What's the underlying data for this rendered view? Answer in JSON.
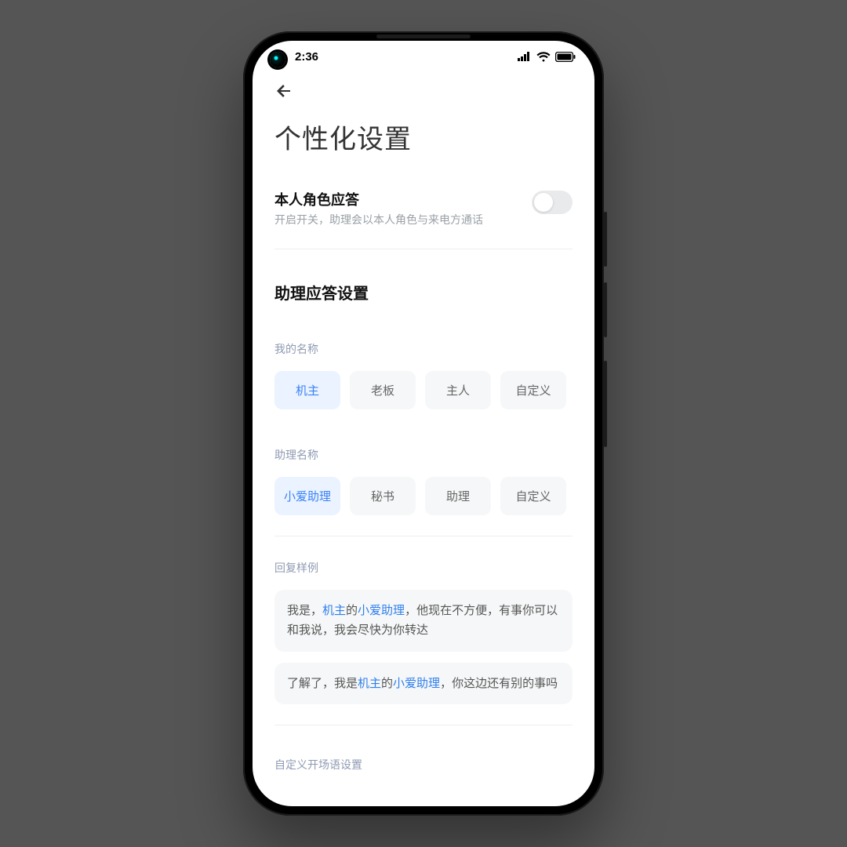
{
  "status": {
    "time": "2:36"
  },
  "nav": {
    "back": "←"
  },
  "page": {
    "title": "个性化设置"
  },
  "toggle": {
    "title": "本人角色应答",
    "subtitle": "开启开关，助理会以本人角色与来电方通话",
    "on": false
  },
  "section": {
    "title": "助理应答设置"
  },
  "myName": {
    "label": "我的名称",
    "options": [
      "机主",
      "老板",
      "主人",
      "自定义"
    ],
    "selected": 0
  },
  "assistantName": {
    "label": "助理名称",
    "options": [
      "小爱助理",
      "秘书",
      "助理",
      "自定义"
    ],
    "selected": 0
  },
  "examples": {
    "label": "回复样例",
    "items": [
      {
        "pre": "我是，",
        "hl1": "机主",
        "mid1": "的",
        "hl2": "小爱助理",
        "post": "，他现在不方便，有事你可以和我说，我会尽快为你转达"
      },
      {
        "pre": "了解了，我是",
        "hl1": "机主",
        "mid1": "的",
        "hl2": "小爱助理",
        "post": "，你这边还有别的事吗"
      }
    ]
  },
  "footer": {
    "customOpening": "自定义开场语设置"
  },
  "colors": {
    "accent": "#2f80ed",
    "chipSelectedBg": "#eaf3ff"
  }
}
